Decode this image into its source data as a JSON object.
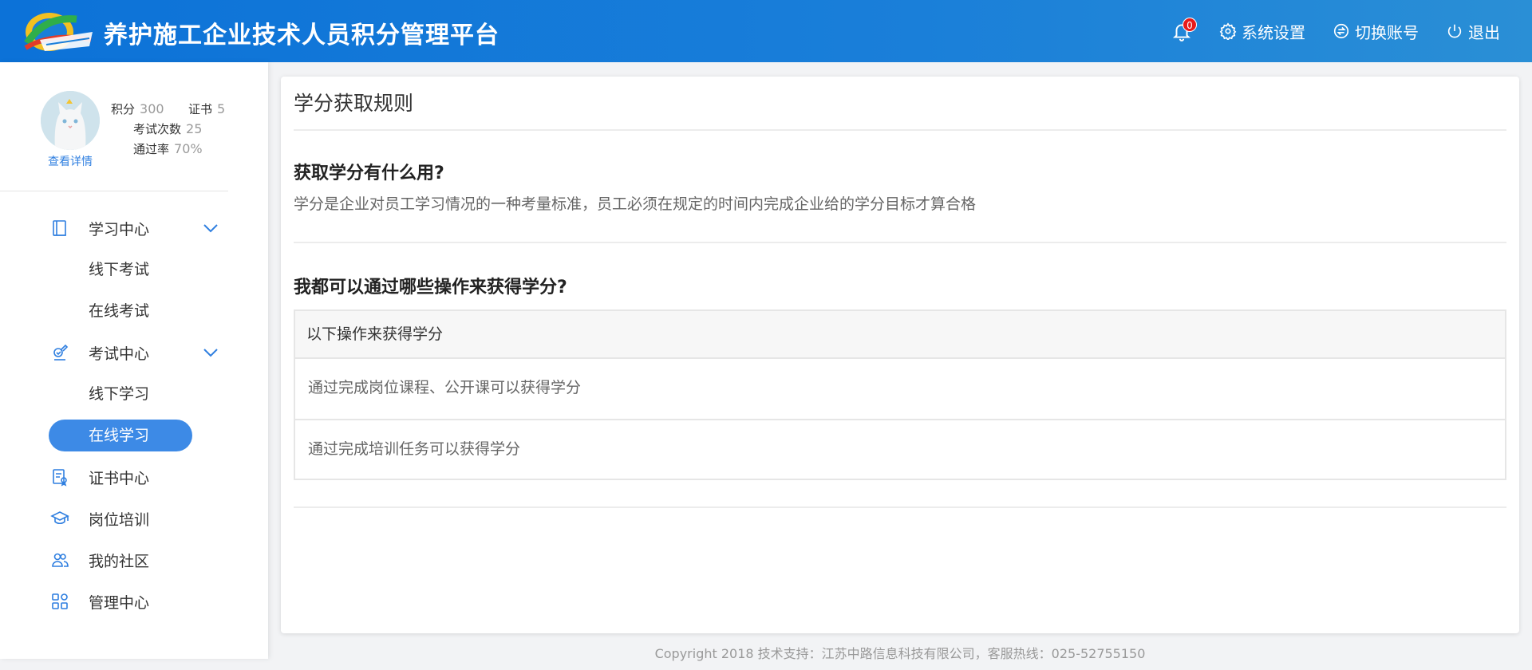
{
  "header": {
    "title": "养护施工企业技术人员积分管理平台",
    "notification_count": "0",
    "settings_label": "系统设置",
    "switch_account_label": "切换账号",
    "logout_label": "退出",
    "icons": [
      "bell-icon",
      "gear-icon",
      "switch-icon",
      "power-icon"
    ]
  },
  "profile": {
    "points_label": "积分",
    "points_value": "300",
    "cert_label": "证书",
    "cert_value": "5",
    "exam_count_label": "考试次数",
    "exam_count_value": "25",
    "pass_rate_label": "通过率",
    "pass_rate_value": "70%",
    "view_detail": "查看详情"
  },
  "sidebar": {
    "learning_center": "学习中心",
    "learning_children": [
      "线下考试",
      "在线考试"
    ],
    "exam_center": "考试中心",
    "exam_children": [
      "线下学习",
      "在线学习"
    ],
    "active_item": "在线学习",
    "certificate_center": "证书中心",
    "post_training": "岗位培训",
    "community": "我的社区",
    "management_center": "管理中心",
    "accent_color": "#3d8ae6"
  },
  "main": {
    "title": "学分获取规则",
    "q1_title": "获取学分有什么用?",
    "q1_text": "学分是企业对员工学习情况的一种考量标准，员工必须在规定的时间内完成企业给的学分目标才算合格",
    "q2_title": "我都可以通过哪些操作来获得学分?",
    "table_header": "以下操作来获得学分",
    "table_rows": [
      "通过完成岗位课程、公开课可以获得学分",
      "通过完成培训任务可以获得学分"
    ]
  },
  "footer": {
    "copyright": "Copyright 2018 技术支持：江苏中路信息科技有限公司，客服热线：025-52755150"
  },
  "colors": {
    "header_start": "#0c72d8",
    "header_end": "#2a8fd6",
    "badge": "#e81b1b",
    "link": "#2f7fe0"
  }
}
